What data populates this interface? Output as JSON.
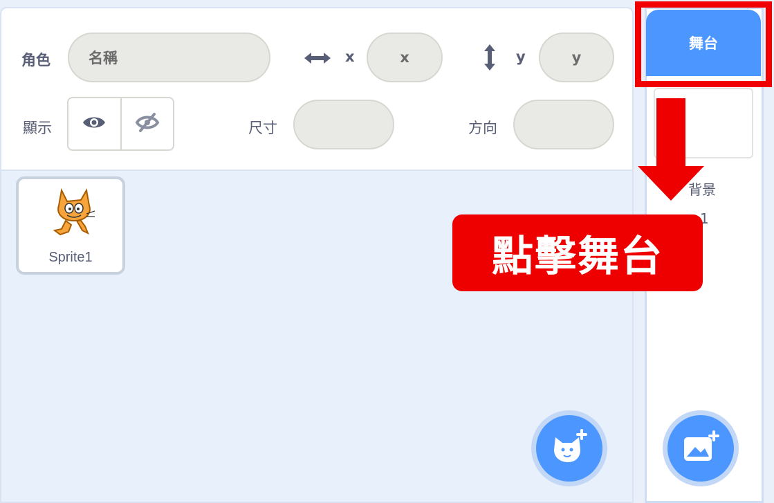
{
  "sprite_info": {
    "sprite_label": "角色",
    "name_placeholder": "名稱",
    "x_label": "x",
    "x_placeholder": "x",
    "y_label": "y",
    "y_placeholder": "y",
    "show_label": "顯示",
    "size_label": "尺寸",
    "direction_label": "方向"
  },
  "sprites": [
    {
      "name": "Sprite1"
    }
  ],
  "stage": {
    "tab_label": "舞台",
    "backdrops_label": "背景",
    "backdrops_count": "1"
  },
  "annotation": {
    "callout_text": "點擊舞台",
    "color": "#ee0000"
  },
  "colors": {
    "accent": "#4c97ff",
    "panel_bg": "#e8f0fb"
  },
  "icons": [
    "arrows-horizontal-icon",
    "arrows-vertical-icon",
    "eye-icon",
    "eye-off-icon",
    "cat-add-icon",
    "backdrop-add-icon",
    "down-arrow-icon"
  ]
}
